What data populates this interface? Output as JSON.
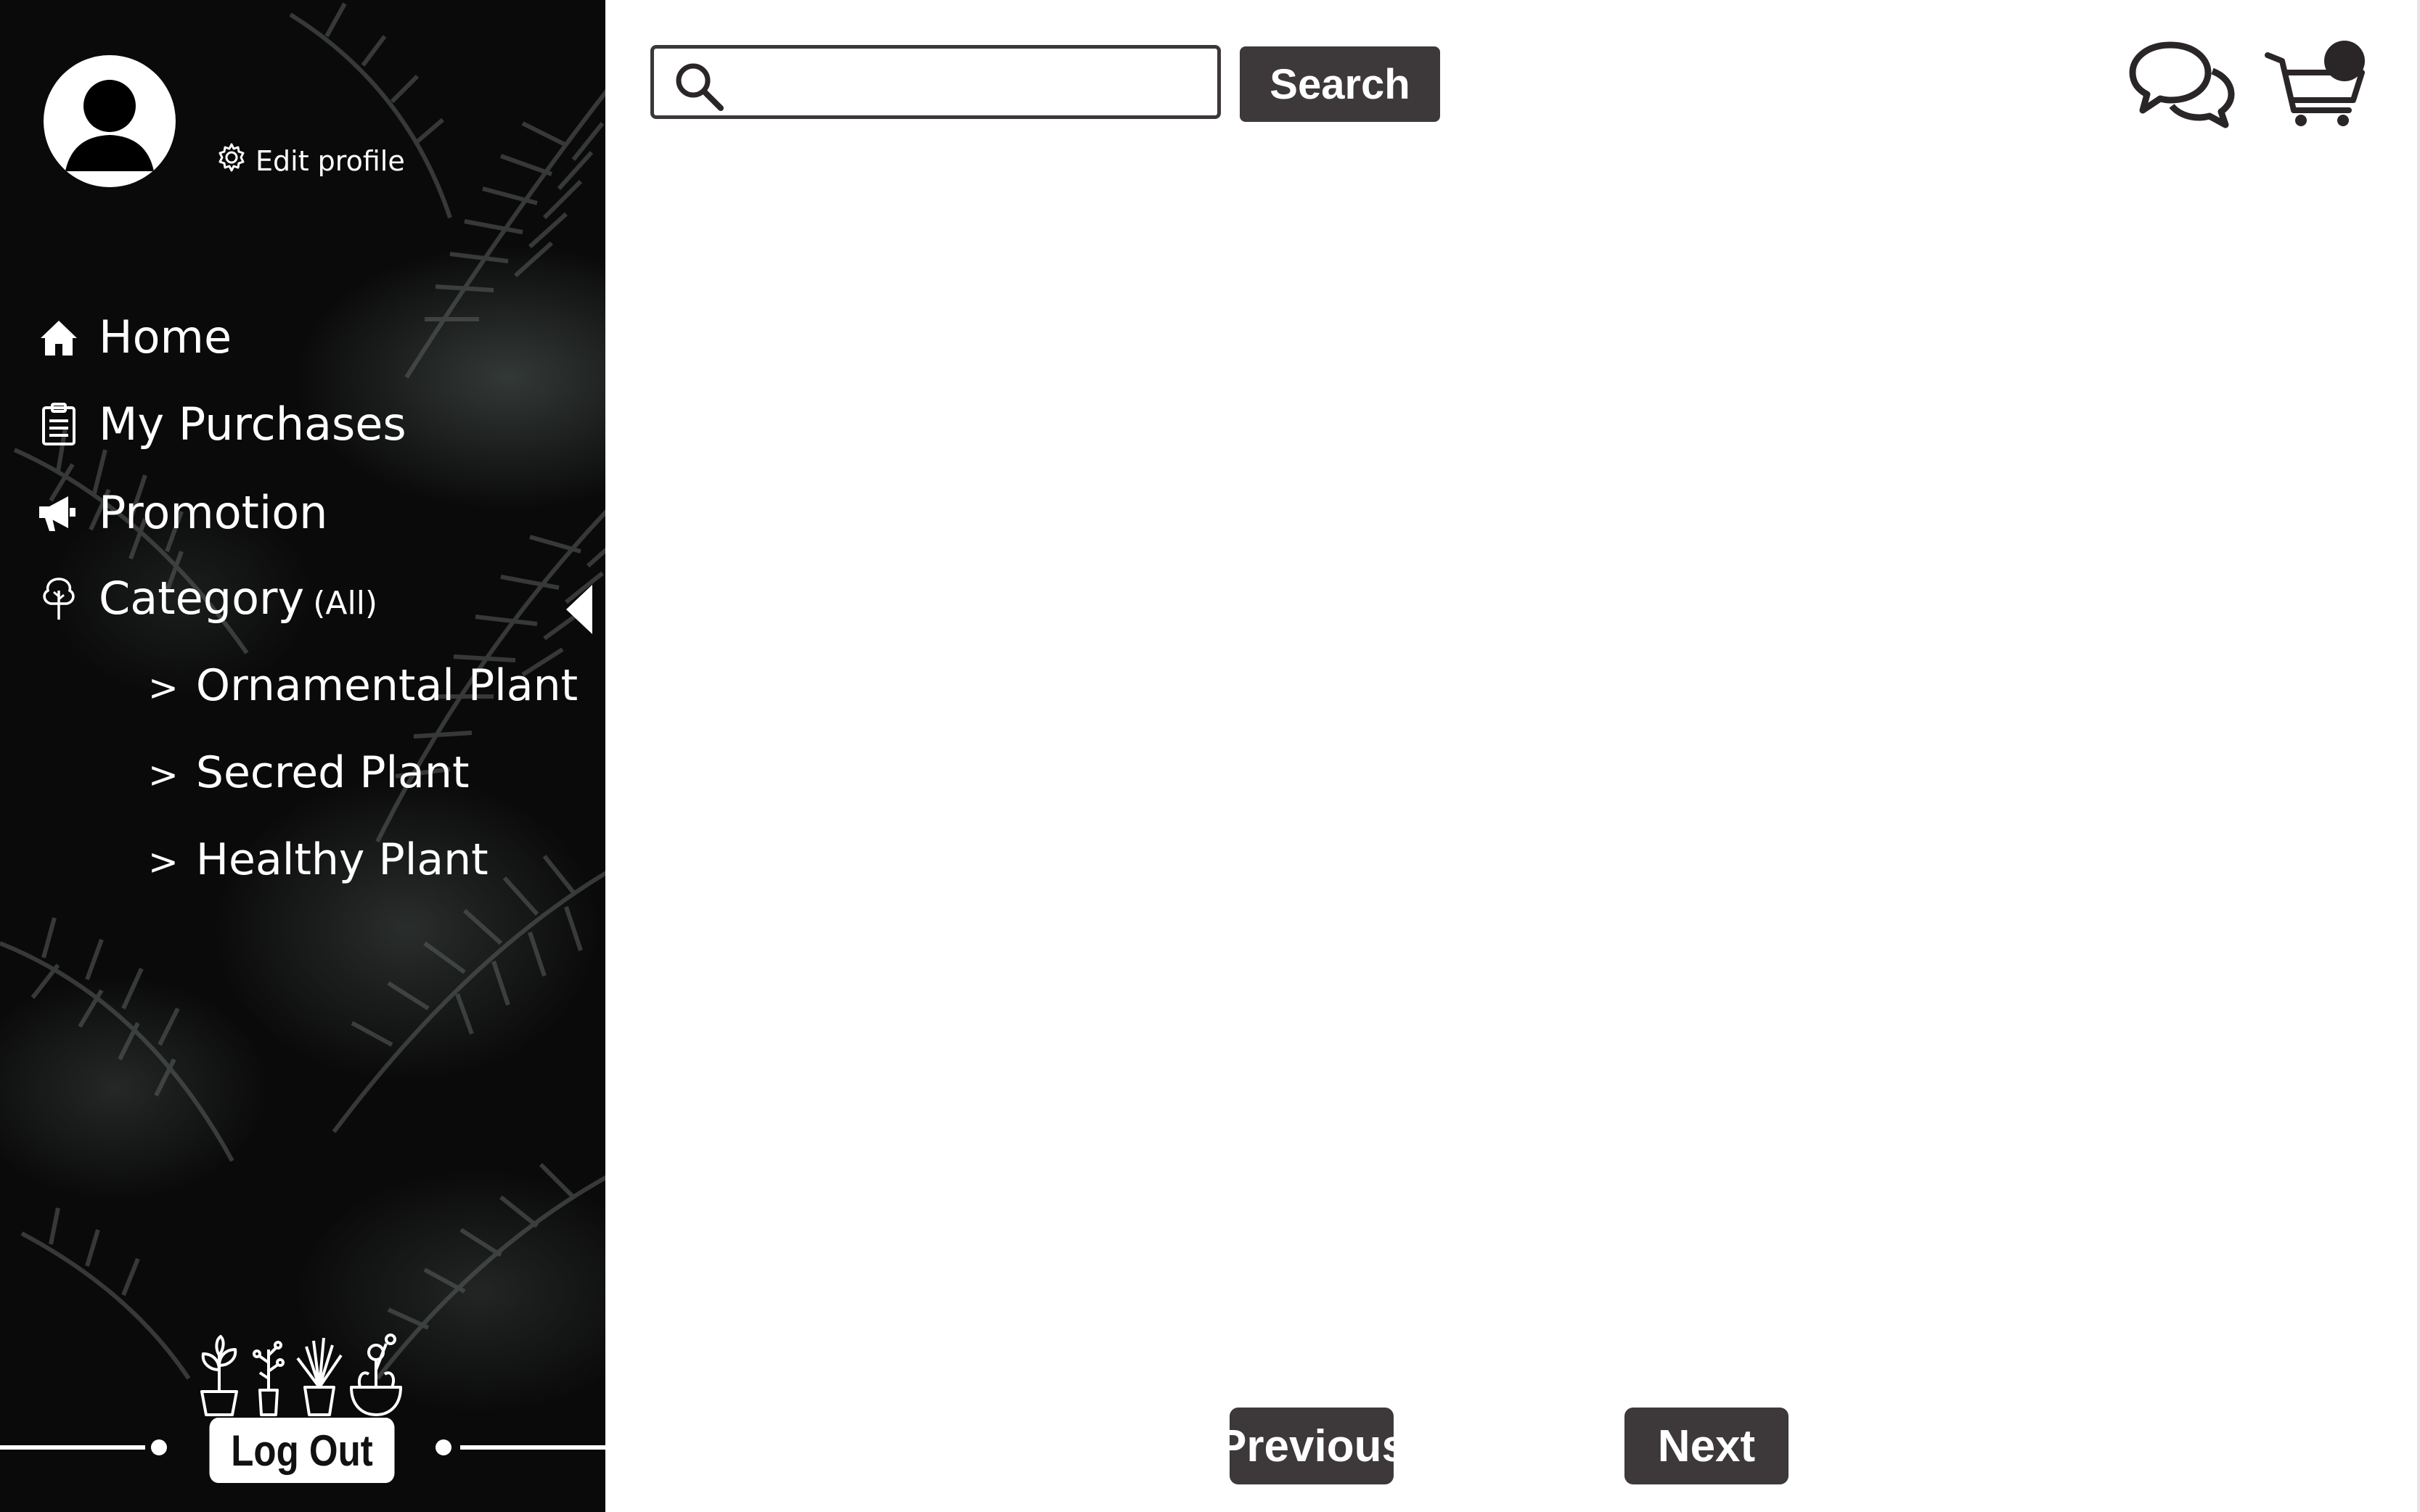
{
  "profile": {
    "edit_label": "Edit profile"
  },
  "nav": {
    "home": "Home",
    "purchases": "My Purchases",
    "promotion": "Promotion",
    "category": "Category",
    "category_filter": "(All)"
  },
  "categories": [
    {
      "label": "Ornamental Plant"
    },
    {
      "label": "Secred Plant"
    },
    {
      "label": "Healthy Plant"
    }
  ],
  "sidebar": {
    "logout_label": "Log Out"
  },
  "search": {
    "placeholder": "",
    "value": "",
    "button_label": "Search"
  },
  "pagination": {
    "previous_label": "Previous",
    "next_label": "Next"
  },
  "icons": {
    "search": "search-icon",
    "chat": "chat-icon",
    "cart": "cart-icon",
    "home": "home-icon",
    "purchases": "clipboard-icon",
    "promotion": "megaphone-icon",
    "category": "tree-icon",
    "settings": "gear-icon",
    "avatar": "user-avatar-icon",
    "collapse": "collapse-arrow-icon"
  },
  "colors": {
    "sidebar_bg": "#0a0a0a",
    "button_bg": "#3d393b",
    "text_light": "#ffffff",
    "border": "#3c383a"
  }
}
